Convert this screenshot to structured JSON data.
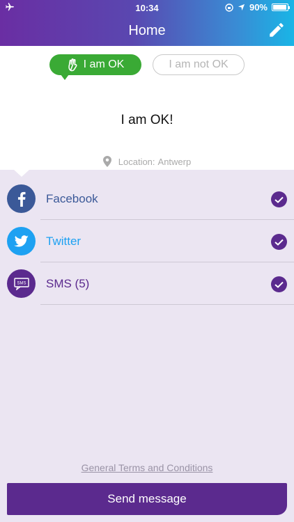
{
  "status_bar": {
    "time": "10:34",
    "battery": "90%",
    "battery_level": 0.9
  },
  "header": {
    "title": "Home",
    "edit_icon": "pencil-icon"
  },
  "status_toggle": {
    "ok_label": "I am OK",
    "not_ok_label": "I am not OK",
    "selected": "ok"
  },
  "message": "I am OK!",
  "location": {
    "prefix": "Location:",
    "value": "Antwerp"
  },
  "channels": [
    {
      "label": "Facebook",
      "color": "#3b5998",
      "icon": "facebook-icon",
      "checked": true
    },
    {
      "label": "Twitter",
      "color": "#1da1f2",
      "icon": "twitter-icon",
      "checked": true
    },
    {
      "label": "SMS (5)",
      "color": "#5b2a8e",
      "icon": "sms-icon",
      "checked": true
    }
  ],
  "terms_link": "General Terms and Conditions",
  "send_button": "Send message",
  "colors": {
    "accent": "#5b2a8e",
    "ok_green": "#3aaa35",
    "list_bg": "#ebe5f2"
  }
}
